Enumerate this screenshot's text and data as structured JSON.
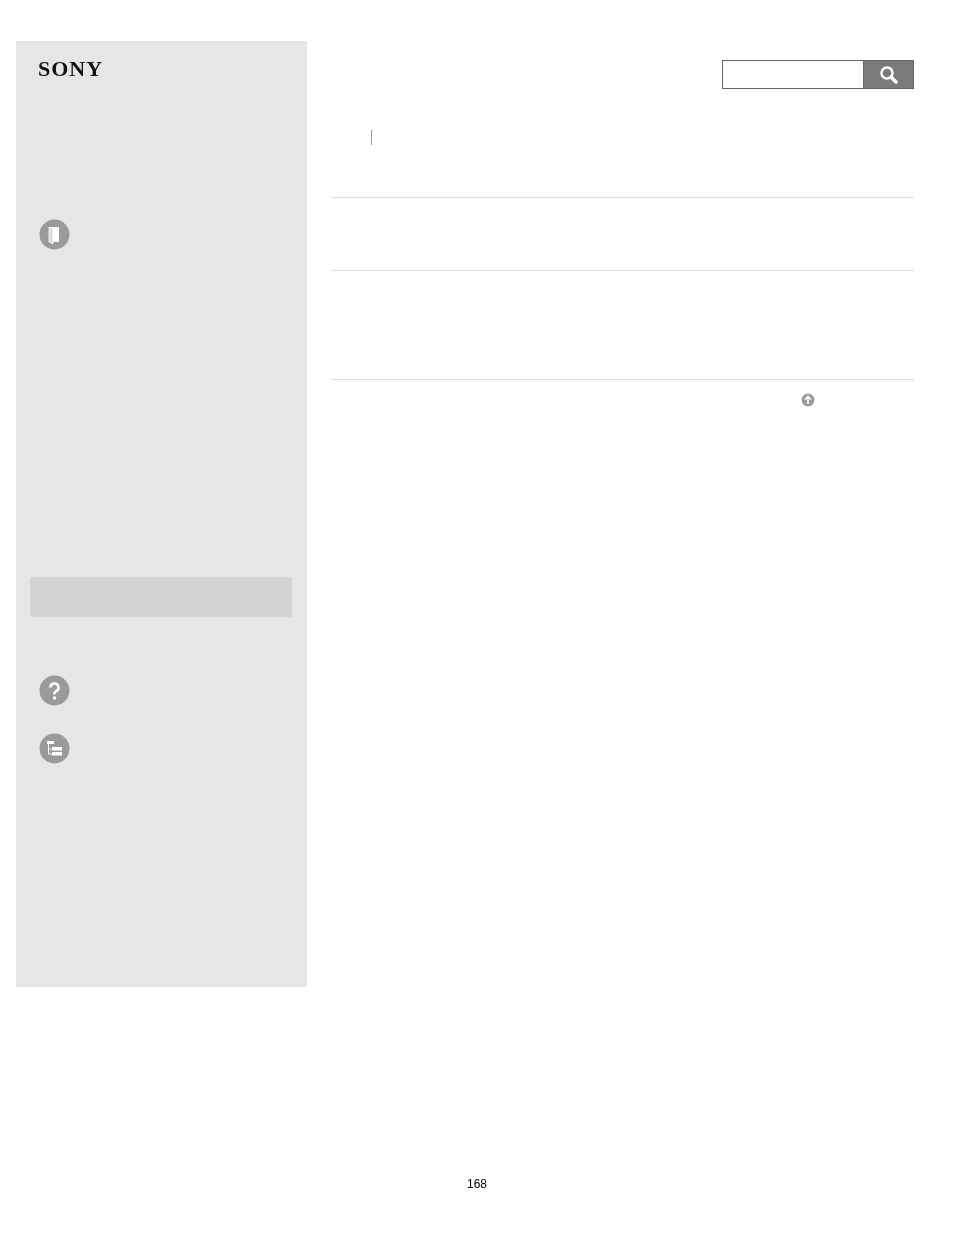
{
  "sidebar": {
    "logo": "SONY"
  },
  "footer": {
    "page_number": "168"
  }
}
